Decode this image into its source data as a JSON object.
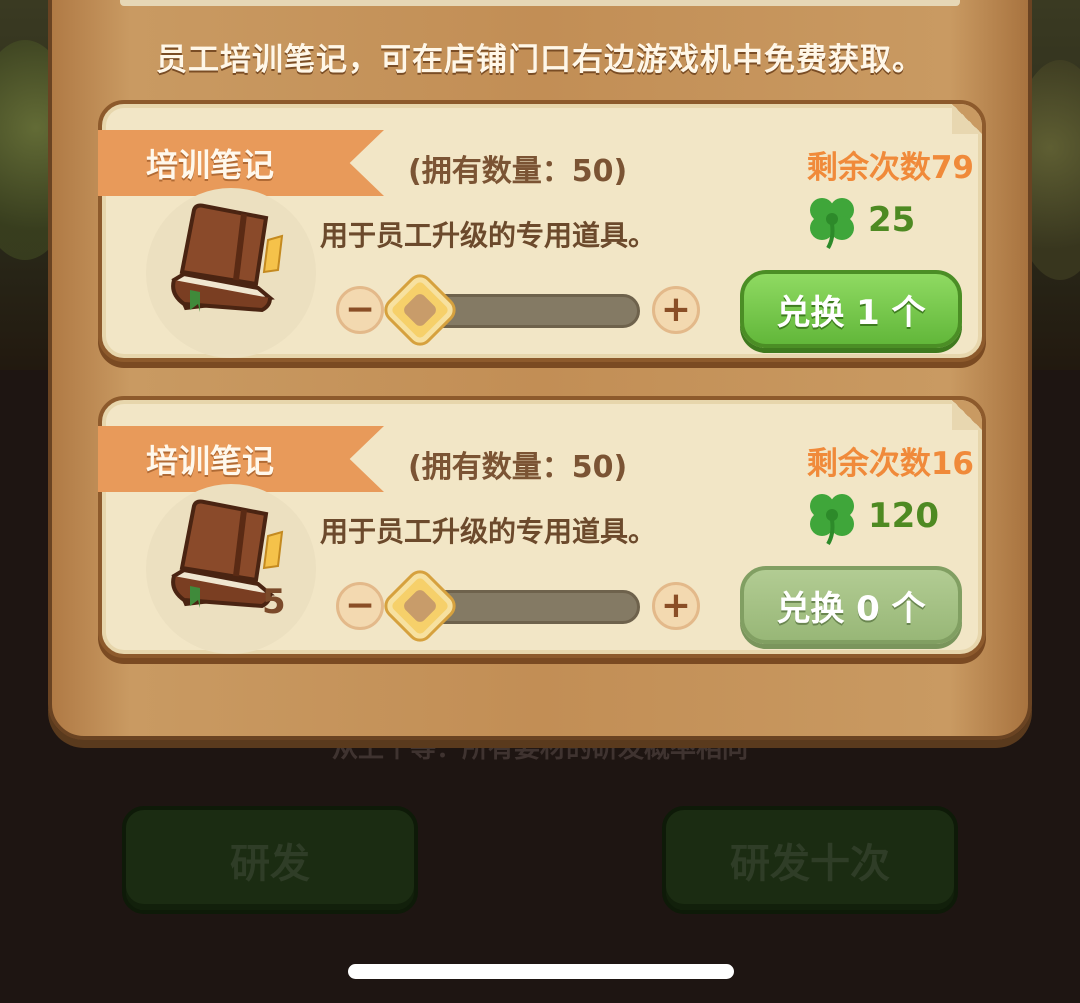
{
  "notice": "员工培训笔记，可在店铺门口右边游戏机中免费获取。",
  "cards": [
    {
      "ribbon": "培训笔记",
      "owned": "(拥有数量：50)",
      "remaining": "剩余次数79",
      "description": "用于员工升级的专用道具。",
      "cost": "25",
      "stack_count": "",
      "minus": "−",
      "plus": "+",
      "exchange_label": "兑换 1 个",
      "slider_level": 0,
      "exchange_enabled": true
    },
    {
      "ribbon": "培训笔记",
      "owned": "(拥有数量：50)",
      "remaining": "剩余次数16",
      "description": "用于员工升级的专用道具。",
      "cost": "120",
      "stack_count": "5",
      "minus": "−",
      "plus": "+",
      "exchange_label": "兑换 0 个",
      "slider_level": 0,
      "exchange_enabled": false
    }
  ],
  "background": {
    "hint": "从上个等：所有要材的研发概率相同",
    "research_button": "研发",
    "research_ten_button": "研发十次"
  },
  "icons": {
    "item": "book-icon",
    "currency": "clover-icon"
  },
  "colors": {
    "remaining_text": "#f08a3a",
    "cost_text": "#4e8a22",
    "exchange_active": "#6cc043",
    "exchange_disabled": "#a4c285",
    "ribbon": "#e89a5a"
  }
}
